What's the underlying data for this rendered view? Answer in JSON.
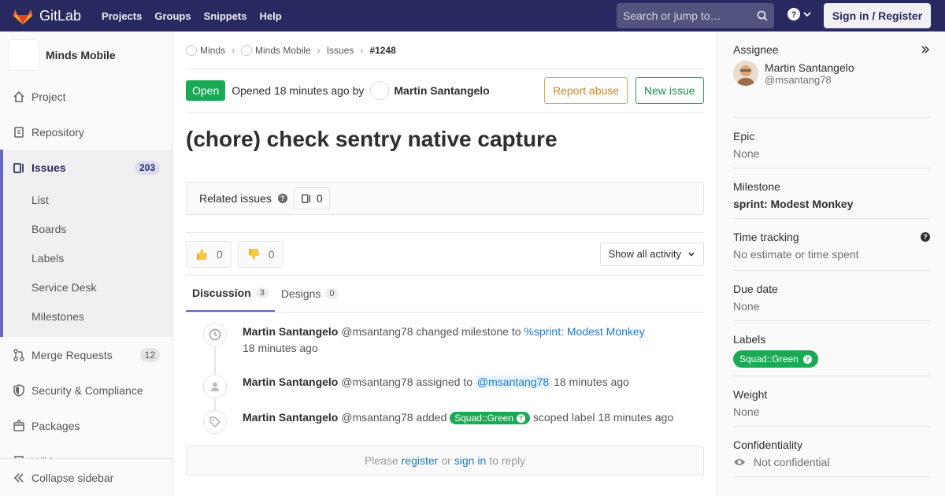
{
  "colors": {
    "navbar": "#292961",
    "accent": "#6666c4",
    "success": "#1aaa55",
    "warning": "#d3831d",
    "link": "#1f78d1"
  },
  "navbar": {
    "brand": "GitLab",
    "links": [
      "Projects",
      "Groups",
      "Snippets",
      "Help"
    ],
    "search_placeholder": "Search or jump to…",
    "signin_label": "Sign in / Register"
  },
  "sidebar": {
    "project_name": "Minds Mobile",
    "items": [
      {
        "label": "Project",
        "icon": "home-icon"
      },
      {
        "label": "Repository",
        "icon": "doc-icon"
      }
    ],
    "active": {
      "label": "Issues",
      "count": "203",
      "icon": "issues-icon"
    },
    "sub_items": [
      "List",
      "Boards",
      "Labels",
      "Service Desk",
      "Milestones"
    ],
    "more_items": [
      {
        "label": "Merge Requests",
        "count": "12",
        "icon": "merge-request-icon"
      },
      {
        "label": "Security & Compliance",
        "icon": "shield-icon"
      },
      {
        "label": "Packages",
        "icon": "package-icon"
      },
      {
        "label": "Wiki",
        "icon": "book-icon"
      }
    ],
    "collapse_label": "Collapse sidebar"
  },
  "breadcrumb": {
    "items": [
      "Minds",
      "Minds Mobile",
      "Issues"
    ],
    "current": "#1248"
  },
  "issue": {
    "status": "Open",
    "opened_text": "Opened 18 minutes ago by",
    "author": "Martin Santangelo",
    "report_abuse_label": "Report abuse",
    "new_issue_label": "New issue",
    "title": "(chore) check sentry native capture",
    "related_label": "Related issues",
    "related_count": "0",
    "thumbs_up": "0",
    "thumbs_down": "0",
    "activity_filter": "Show all activity"
  },
  "tabs": [
    {
      "label": "Discussion",
      "count": "3"
    },
    {
      "label": "Designs",
      "count": "0"
    }
  ],
  "events": {
    "e1": {
      "author": "Martin Santangelo",
      "handle": "@msantang78",
      "action": "changed milestone to",
      "link": "%sprint: Modest Monkey",
      "time": "18 minutes ago"
    },
    "e2": {
      "author": "Martin Santangelo",
      "handle": "@msantang78",
      "action": "assigned to",
      "mention": "@msantang78",
      "time": "18 minutes ago"
    },
    "e3": {
      "author": "Martin Santangelo",
      "handle": "@msantang78",
      "action": "added",
      "label": "Squad::Green",
      "suffix": "scoped label",
      "time": "18 minutes ago"
    }
  },
  "reply": {
    "please": "Please",
    "register": "register",
    "or": "or",
    "signin": "sign in",
    "to_reply": "to reply"
  },
  "right_sidebar": {
    "assignee_title": "Assignee",
    "assignee_name": "Martin Santangelo",
    "assignee_user": "@msantang78",
    "epic_title": "Epic",
    "epic_value": "None",
    "milestone_title": "Milestone",
    "milestone_value": "sprint: Modest Monkey",
    "time_title": "Time tracking",
    "time_value": "No estimate or time spent",
    "due_title": "Due date",
    "due_value": "None",
    "labels_title": "Labels",
    "label_value": "Squad::Green",
    "weight_title": "Weight",
    "weight_value": "None",
    "conf_title": "Confidentiality",
    "conf_value": "Not confidential"
  }
}
